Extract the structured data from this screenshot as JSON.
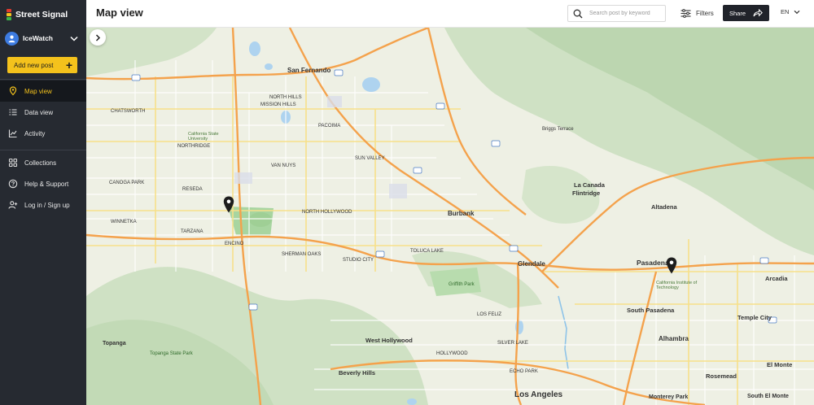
{
  "brand": {
    "name": "Street Signal",
    "colors": [
      "#e23b2e",
      "#f4c21c",
      "#3bb54a"
    ]
  },
  "account": {
    "name": "IceWatch",
    "icon": "user-avatar-icon"
  },
  "sidebar": {
    "add_post_label": "Add new post",
    "primary": [
      {
        "label": "Map view",
        "icon": "map-pin-icon",
        "active": true
      },
      {
        "label": "Data view",
        "icon": "list-icon"
      },
      {
        "label": "Activity",
        "icon": "activity-chart-icon"
      }
    ],
    "secondary": [
      {
        "label": "Collections",
        "icon": "grid-icon"
      },
      {
        "label": "Help & Support",
        "icon": "help-icon"
      },
      {
        "label": "Log in / Sign up",
        "icon": "add-user-icon"
      }
    ]
  },
  "header": {
    "title": "Map view",
    "search_placeholder": "Search post by keyword",
    "filters_label": "Filters",
    "share_label": "Share",
    "language": "EN"
  },
  "colors": {
    "accent": "#f4c21c",
    "sidebar_bg": "#262a31",
    "active_bg": "#15181d"
  },
  "map": {
    "labels": {
      "san_fernando": "San Fernando",
      "burbank": "Burbank",
      "glendale": "Glendale",
      "pasadena": "Pasadena",
      "la_canada": "La Canada",
      "flintridge": "Flintridge",
      "altadena": "Altadena",
      "arcadia": "Arcadia",
      "south_pasadena": "South Pasadena",
      "temple_city": "Temple City",
      "alhambra": "Alhambra",
      "west_hollywood": "West Hollywood",
      "beverly_hills": "Beverly Hills",
      "los_angeles": "Los Angeles",
      "el_monte": "El Monte",
      "rosemead": "Rosemead",
      "south_el_monte": "South El Monte",
      "monterey_park": "Monterey Park",
      "topanga": "Topanga",
      "encino": "ENCINO",
      "sherman_oaks": "SHERMAN OAKS",
      "van_nuys": "VAN NUYS",
      "north_hills": "NORTH HILLS",
      "northridge": "NORTHRIDGE",
      "mission_hills": "MISSION HILLS",
      "tarzana": "TARZANA",
      "reseda": "RESEDA",
      "sun_valley": "SUN VALLEY",
      "pacoima": "PACOIMA",
      "north_hollywood": "NORTH HOLLYWOOD",
      "studio_city": "STUDIO CITY",
      "toluca_lake": "TOLUCA LAKE",
      "los_feliz": "LOS FELIZ",
      "silver_lake": "SILVER LAKE",
      "echo_park": "ECHO PARK",
      "hollywood": "HOLLYWOOD",
      "csun": "California State University",
      "caltech": "California Institute of Technology",
      "griffith_park": "Griffith Park",
      "topanga_state_park": "Topanga State Park",
      "briggs_terrace": "Briggs Terrace",
      "chatsworth": "CHATSWORTH",
      "canoga_park": "CANOGA PARK",
      "winnetka": "WINNETKA"
    },
    "pins": [
      {
        "name": "report-pin-1"
      },
      {
        "name": "report-pin-2"
      }
    ]
  }
}
